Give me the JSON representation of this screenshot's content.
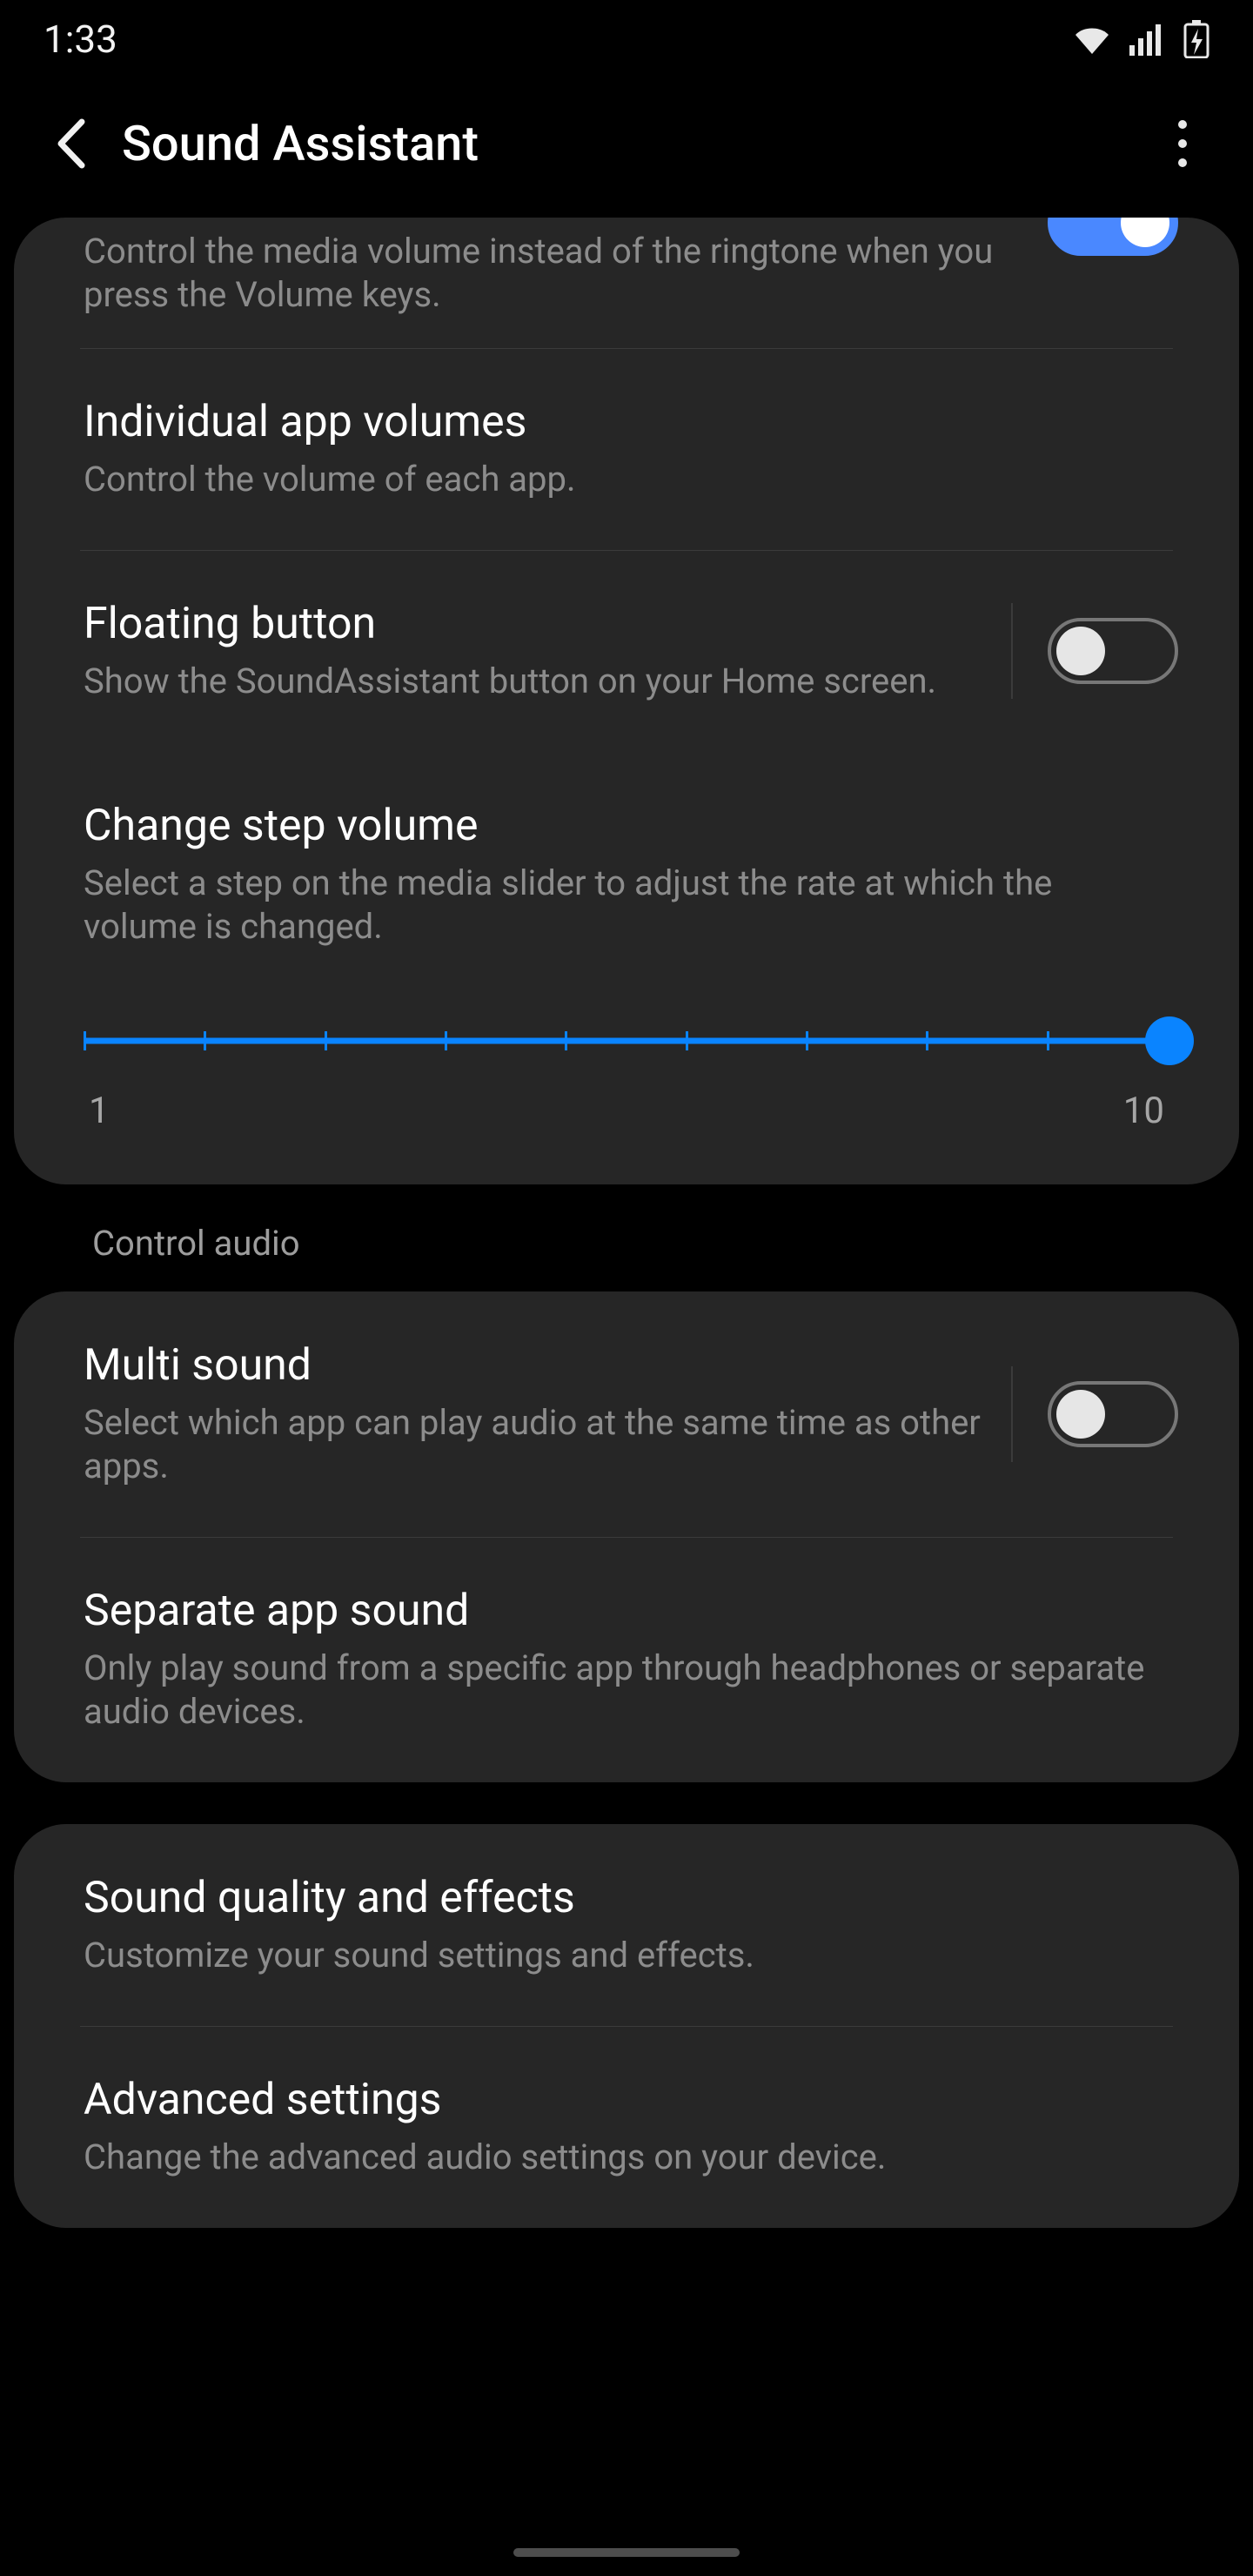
{
  "status": {
    "time": "1:33"
  },
  "appbar": {
    "title": "Sound Assistant"
  },
  "items": {
    "media_keys": {
      "sub": "Control the media volume instead of the ringtone when you press the Volume keys.",
      "on": true
    },
    "individual": {
      "title": "Individual app volumes",
      "sub": "Control the volume of each app."
    },
    "floating": {
      "title": "Floating button",
      "sub": "Show the SoundAssistant button on your Home screen.",
      "on": false
    },
    "step": {
      "title": "Change step volume",
      "sub": "Select a step on the media slider to adjust the rate at which the volume is changed.",
      "min_label": "1",
      "max_label": "10",
      "min": 1,
      "max": 10,
      "value": 10
    }
  },
  "sections": {
    "control_audio": "Control audio"
  },
  "items2": {
    "multi": {
      "title": "Multi sound",
      "sub": "Select which app can play audio at the same time as other apps.",
      "on": false
    },
    "separate": {
      "title": "Separate app sound",
      "sub": "Only play sound from a specific app through headphones or separate audio devices."
    }
  },
  "items3": {
    "quality": {
      "title": "Sound quality and effects",
      "sub": "Customize your sound settings and effects."
    },
    "advanced": {
      "title": "Advanced settings",
      "sub": "Change the advanced audio settings on your device."
    }
  }
}
